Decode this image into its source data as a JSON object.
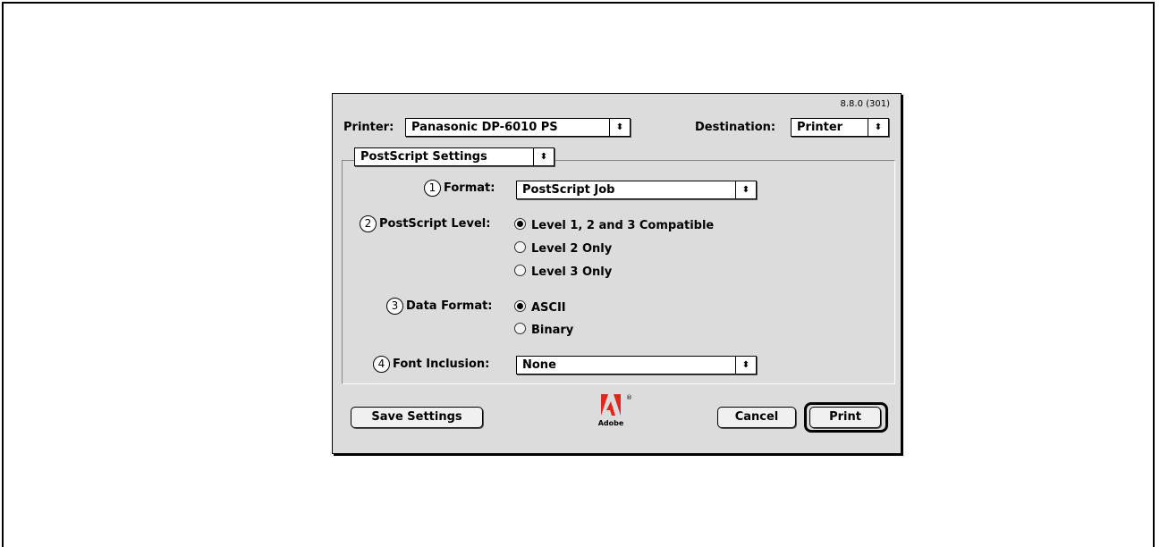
{
  "dialog": {
    "version": "8.8.0 (301)",
    "printer_label": "Printer:",
    "printer_value": "Panasonic DP-6010 PS",
    "destination_label": "Destination:",
    "destination_value": "Printer",
    "panel_value": "PostScript Settings"
  },
  "settings": {
    "format": {
      "num": "1",
      "label": "Format:",
      "value": "PostScript Job"
    },
    "level": {
      "num": "2",
      "label": "PostScript Level:",
      "options": [
        "Level 1, 2 and 3 Compatible",
        "Level 2 Only",
        "Level 3 Only"
      ],
      "selected": "Level 1, 2 and 3 Compatible"
    },
    "data_format": {
      "num": "3",
      "label": "Data Format:",
      "options": [
        "ASCII",
        "Binary"
      ],
      "selected": "ASCII"
    },
    "font_inclusion": {
      "num": "4",
      "label": "Font Inclusion:",
      "value": "None"
    }
  },
  "buttons": {
    "save": "Save Settings",
    "cancel": "Cancel",
    "print": "Print"
  },
  "logo": {
    "text": "Adobe",
    "mark": "®",
    "color": "#e1261c"
  }
}
